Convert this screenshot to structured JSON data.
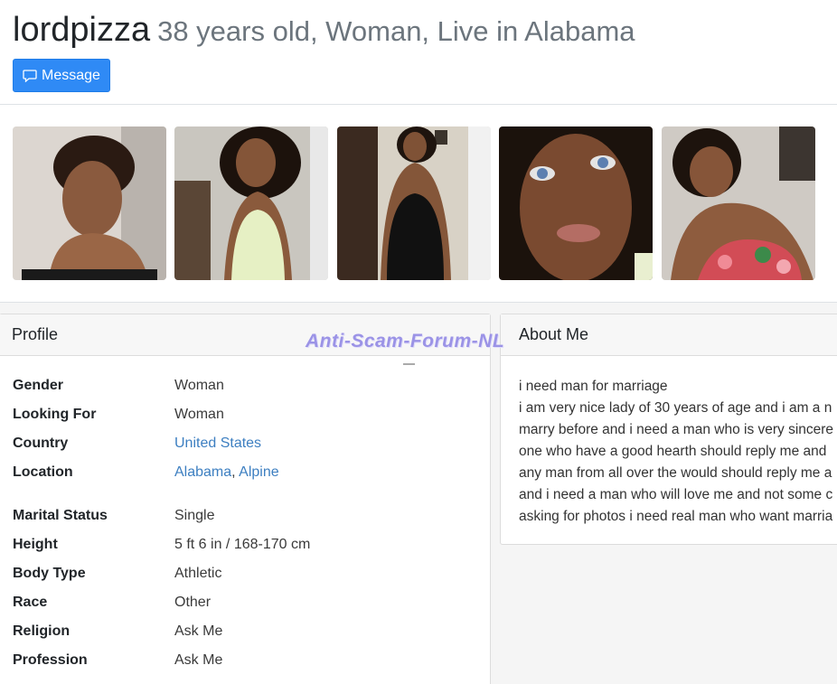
{
  "header": {
    "username": "lordpizza",
    "subtitle": "38 years old, Woman, Live in Alabama",
    "message_button": "Message"
  },
  "photos": [
    {
      "icon": "photo-thumbnail"
    },
    {
      "icon": "photo-thumbnail"
    },
    {
      "icon": "photo-thumbnail"
    },
    {
      "icon": "photo-thumbnail"
    },
    {
      "icon": "photo-thumbnail"
    }
  ],
  "profile": {
    "title": "Profile",
    "gender": {
      "label": "Gender",
      "value": "Woman"
    },
    "looking_for": {
      "label": "Looking For",
      "value": "Woman"
    },
    "country": {
      "label": "Country",
      "value": "United States"
    },
    "location": {
      "label": "Location",
      "state": "Alabama",
      "separator": ", ",
      "city": "Alpine"
    },
    "marital_status": {
      "label": "Marital Status",
      "value": "Single"
    },
    "height": {
      "label": "Height",
      "value": "5 ft 6 in / 168-170 cm"
    },
    "body_type": {
      "label": "Body Type",
      "value": "Athletic"
    },
    "race": {
      "label": "Race",
      "value": "Other"
    },
    "religion": {
      "label": "Religion",
      "value": "Ask Me"
    },
    "profession": {
      "label": "Profession",
      "value": "Ask Me"
    }
  },
  "about": {
    "title": "About Me",
    "lines": [
      "i need man for marriage",
      "i am very nice lady of 30 years of age and i am a n",
      "marry before and i need a man who is very sincere",
      "one who have a good hearth should reply me and",
      "any man from all over the would should reply me a",
      "and i need a man who will love me and not some c",
      "asking for photos i need real man who want marria"
    ]
  },
  "watermark": "Anti-Scam-Forum-NL",
  "colors": {
    "button": "#2f8af5",
    "link": "#3d7fc1",
    "muted_text": "#6c757d",
    "watermark": "#9b93e6",
    "panel_bg": "#f5f5f5"
  }
}
